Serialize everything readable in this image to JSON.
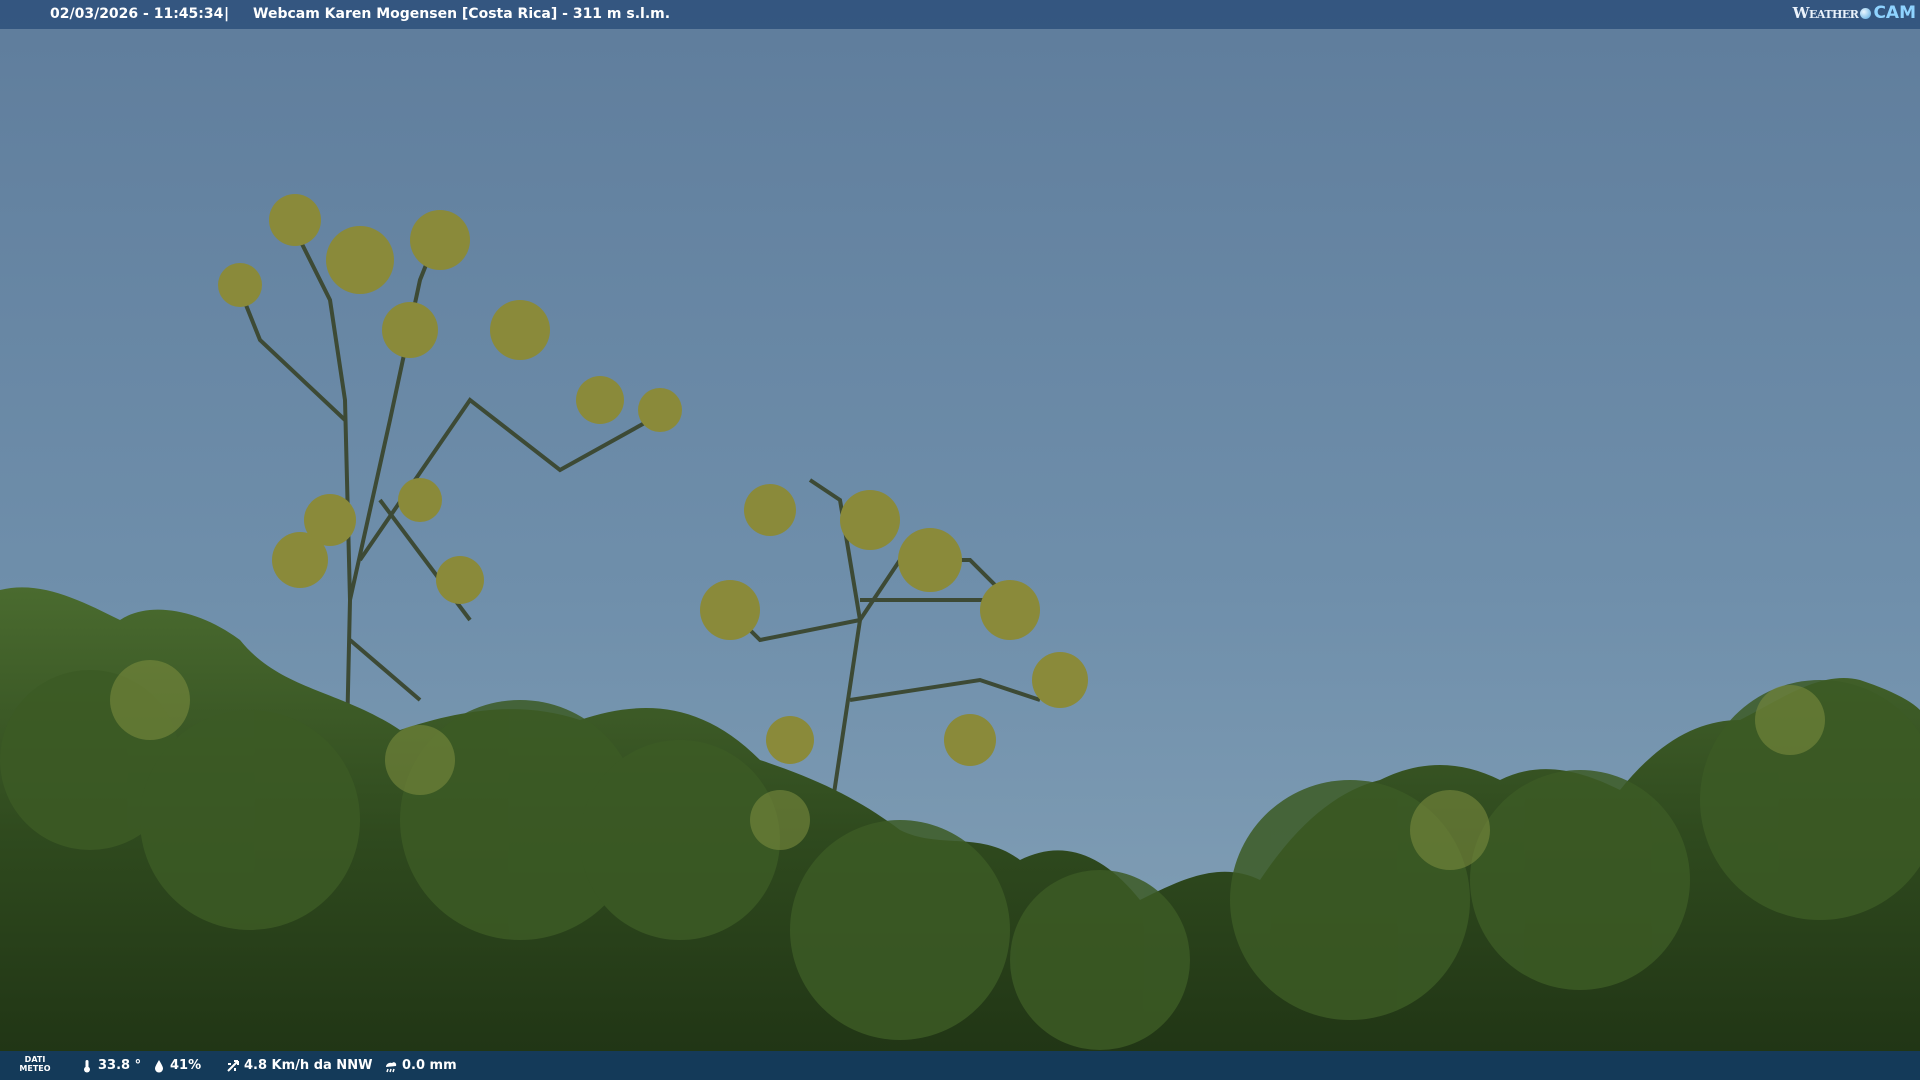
{
  "header": {
    "datetime": "02/03/2026 - 11:45:34",
    "separator": "|",
    "title": "Webcam Karen Mogensen [Costa Rica] - 311 m s.l.m.",
    "logo_word": "Weather",
    "logo_cam": "CAM"
  },
  "footer": {
    "dati_line1": "DATI",
    "dati_line2": "METEO",
    "temperature": "33.8 °",
    "humidity": "41%",
    "wind": "4.8 Km/h da NNW",
    "rain": "0.0 mm",
    "icons": [
      "thermometer-icon",
      "humidity-icon",
      "wind-icon",
      "rain-icon"
    ]
  },
  "colors": {
    "sky_top": "#617f9e",
    "sky_bottom": "#7e9cb4",
    "foliage": "#2f4a1e"
  }
}
